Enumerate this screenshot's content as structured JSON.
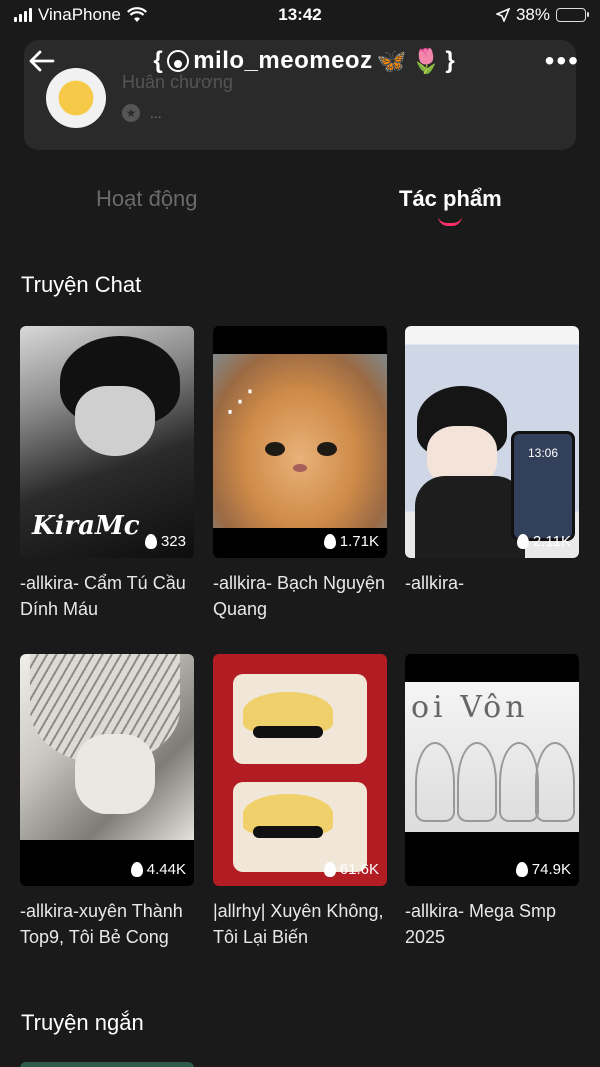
{
  "status_bar": {
    "carrier": "VinaPhone",
    "time": "13:42",
    "battery": "38%"
  },
  "header": {
    "title_start": "{",
    "title_name": "milo_meomeoz",
    "title_end": "}",
    "butterfly_emoji": "🦋",
    "tulip_emoji": "🌷",
    "more": "•••"
  },
  "achievement": {
    "label": "Huân chương",
    "sub": "..."
  },
  "tabs": {
    "activity": "Hoạt động",
    "works": "Tác phẩm"
  },
  "sections": {
    "chat_title": "Truyện Chat",
    "short_title": "Truyện ngắn"
  },
  "cards": [
    {
      "views": "323",
      "title": "-allkira- Cẩm Tú Cầu Dính Máu",
      "cover_logo": "KiraMc"
    },
    {
      "views": "1.71K",
      "title": "-allkira- Bạch Nguyện Quang"
    },
    {
      "views": "2.11K",
      "title": "-allkira-",
      "cover_time": "13:06"
    },
    {
      "views": "4.44K",
      "title": "-allkira-xuyên Thành Top9, Tôi Bẻ Cong"
    },
    {
      "views": "61.6K",
      "title": "|allrhy| Xuyên Không, Tôi Lại Biến"
    },
    {
      "views": "74.9K",
      "title": "-allkira- Mega Smp 2025",
      "cover_text": "oi Vôn"
    }
  ]
}
